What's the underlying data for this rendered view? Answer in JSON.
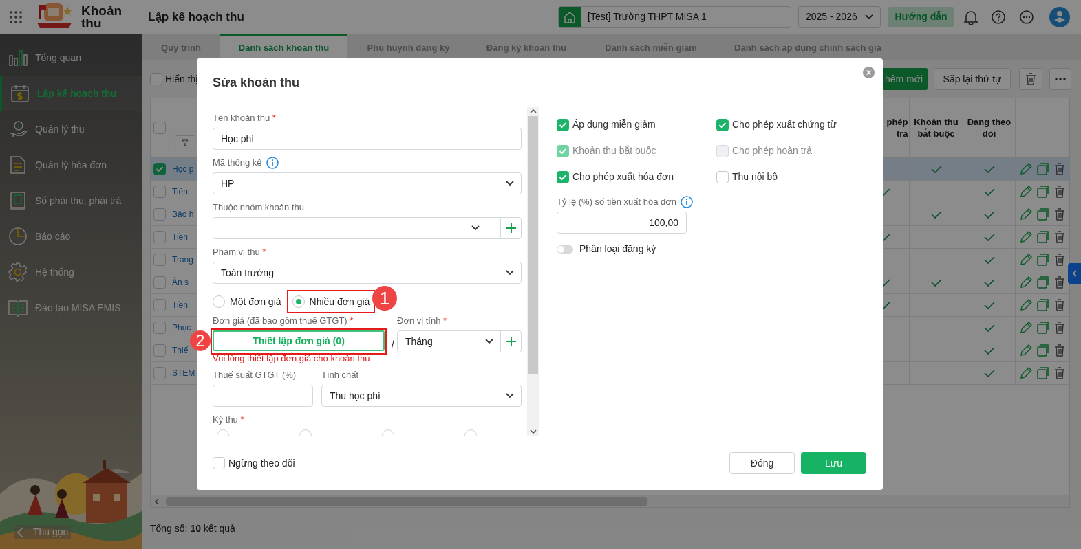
{
  "header": {
    "app_name": "Khoản thu",
    "page_title": "Lập kế hoạch thu",
    "school": "[Test] Trường THPT MISA 1",
    "year": "2025 - 2026",
    "guide_button": "Hướng dẫn"
  },
  "sidebar": {
    "items": [
      {
        "label": "Tổng quan",
        "selected": false
      },
      {
        "label": "Lập kế hoạch thu",
        "selected": true
      },
      {
        "label": "Quản lý thu",
        "selected": false
      },
      {
        "label": "Quản lý hóa đơn",
        "selected": false
      },
      {
        "label": "Sổ phải thu, phải trả",
        "selected": false
      },
      {
        "label": "Báo cáo",
        "selected": false
      },
      {
        "label": "Hệ thống",
        "selected": false
      },
      {
        "label": "Đào tạo MISA EMIS",
        "selected": false
      }
    ],
    "collapse": "Thu gọn"
  },
  "tabs": [
    {
      "label": "Quy trình",
      "selected": false
    },
    {
      "label": "Danh sách khoản thu",
      "selected": true
    },
    {
      "label": "Phụ huynh đăng ký",
      "selected": false
    },
    {
      "label": "Đăng ký khoản thu",
      "selected": false
    },
    {
      "label": "Danh sách miễn giảm",
      "selected": false
    },
    {
      "label": "Danh sách áp dụng chính sách giá",
      "selected": false
    }
  ],
  "toolbar": {
    "show_checkbox": {
      "label": "Hiển thị",
      "checked": false
    },
    "add_button": "hêm mới",
    "reorder_button": "Sắp lại thứ tự"
  },
  "table": {
    "header_checked": false,
    "columns": [
      {
        "label": "phép trả"
      },
      {
        "label": "Khoản thu bắt buộc"
      },
      {
        "label": "Đang theo dõi"
      }
    ],
    "rows": [
      {
        "checked": true,
        "selected": true,
        "name": "Học p",
        "column_3": false,
        "required": true,
        "tracking": true
      },
      {
        "checked": false,
        "selected": false,
        "name": "Tiền",
        "column_3": true,
        "required": false,
        "tracking": true
      },
      {
        "checked": false,
        "selected": false,
        "name": "Bảo h",
        "column_3": false,
        "required": true,
        "tracking": true
      },
      {
        "checked": false,
        "selected": false,
        "name": "Tiền",
        "column_3": true,
        "required": false,
        "tracking": true
      },
      {
        "checked": false,
        "selected": false,
        "name": "Trang",
        "column_3": false,
        "required": false,
        "tracking": true
      },
      {
        "checked": false,
        "selected": false,
        "name": "Ăn s",
        "column_3": true,
        "required": true,
        "tracking": true
      },
      {
        "checked": false,
        "selected": false,
        "name": "Tiền",
        "column_3": true,
        "required": false,
        "tracking": true
      },
      {
        "checked": false,
        "selected": false,
        "name": "Phục",
        "column_3": false,
        "required": false,
        "tracking": true
      },
      {
        "checked": false,
        "selected": false,
        "name": "Thiế",
        "column_3": false,
        "required": false,
        "tracking": true
      },
      {
        "checked": false,
        "selected": false,
        "name": "STEM",
        "column_3": false,
        "required": false,
        "tracking": true
      }
    ]
  },
  "footer": {
    "total": "Tổng số: **10** kết quả"
  },
  "dialog": {
    "title": "Sửa khoản thu",
    "name_field": {
      "label": "Tên khoản thu",
      "mark": "*",
      "value": "Học phí"
    },
    "stat_code": {
      "label": "Mã thống kê",
      "value": "HP"
    },
    "group": {
      "label": "Thuộc nhóm khoản thu"
    },
    "scope": {
      "label": "Phạm vi thu",
      "mark": "*",
      "value": "Toàn trường"
    },
    "price_modes": [
      {
        "label": "Một đơn giá",
        "selected": false
      },
      {
        "label": "Nhiều đơn giá",
        "selected": true
      }
    ],
    "price": {
      "label": "Đơn giá (đã bao gồm thuế GTGT)",
      "mark": "*",
      "button": "Thiết lập đơn giá (0)",
      "separator": "/",
      "error": "Vui lòng thiết lập đơn giá cho khoản thu"
    },
    "unit": {
      "label": "Đơn vị tính",
      "mark": "*",
      "value": "Tháng"
    },
    "vat": {
      "label": "Thuế suất GTGT (%)"
    },
    "nature": {
      "label": "Tính chất",
      "value": "Thu học phí"
    },
    "period": {
      "label": "Kỳ thu",
      "mark": "*"
    },
    "period_options": [
      {
        "selected": false
      },
      {
        "selected": false
      },
      {
        "selected": false
      },
      {
        "selected": false
      }
    ],
    "options": [
      {
        "label": "Áp dụng miễn giảm",
        "checked": true,
        "disabled": false
      },
      {
        "label": "Cho phép xuất chứng từ",
        "checked": true,
        "disabled": false
      },
      {
        "label": "Khoản thu bắt buộc",
        "checked": true,
        "disabled": true
      },
      {
        "label": "Cho phép hoàn trả",
        "checked": false,
        "disabled": true
      },
      {
        "label": "Cho phép xuất hóa đơn",
        "checked": true,
        "disabled": false
      },
      {
        "label": "Thu nội bộ",
        "checked": false,
        "disabled": false
      }
    ],
    "invoice_rate": {
      "label": "Tỷ lệ (%) số tiền xuất hóa đơn",
      "value": "100,00"
    },
    "register_toggle": {
      "label": "Phân loại đăng ký",
      "on": false
    },
    "stop_tracking": {
      "label": "Ngừng theo dõi",
      "checked": false
    },
    "buttons": [
      {
        "label": "Đóng",
        "kind": "secondary"
      },
      {
        "label": "Lưu",
        "kind": "primary"
      }
    ]
  },
  "annotations": [
    "1",
    "2"
  ]
}
